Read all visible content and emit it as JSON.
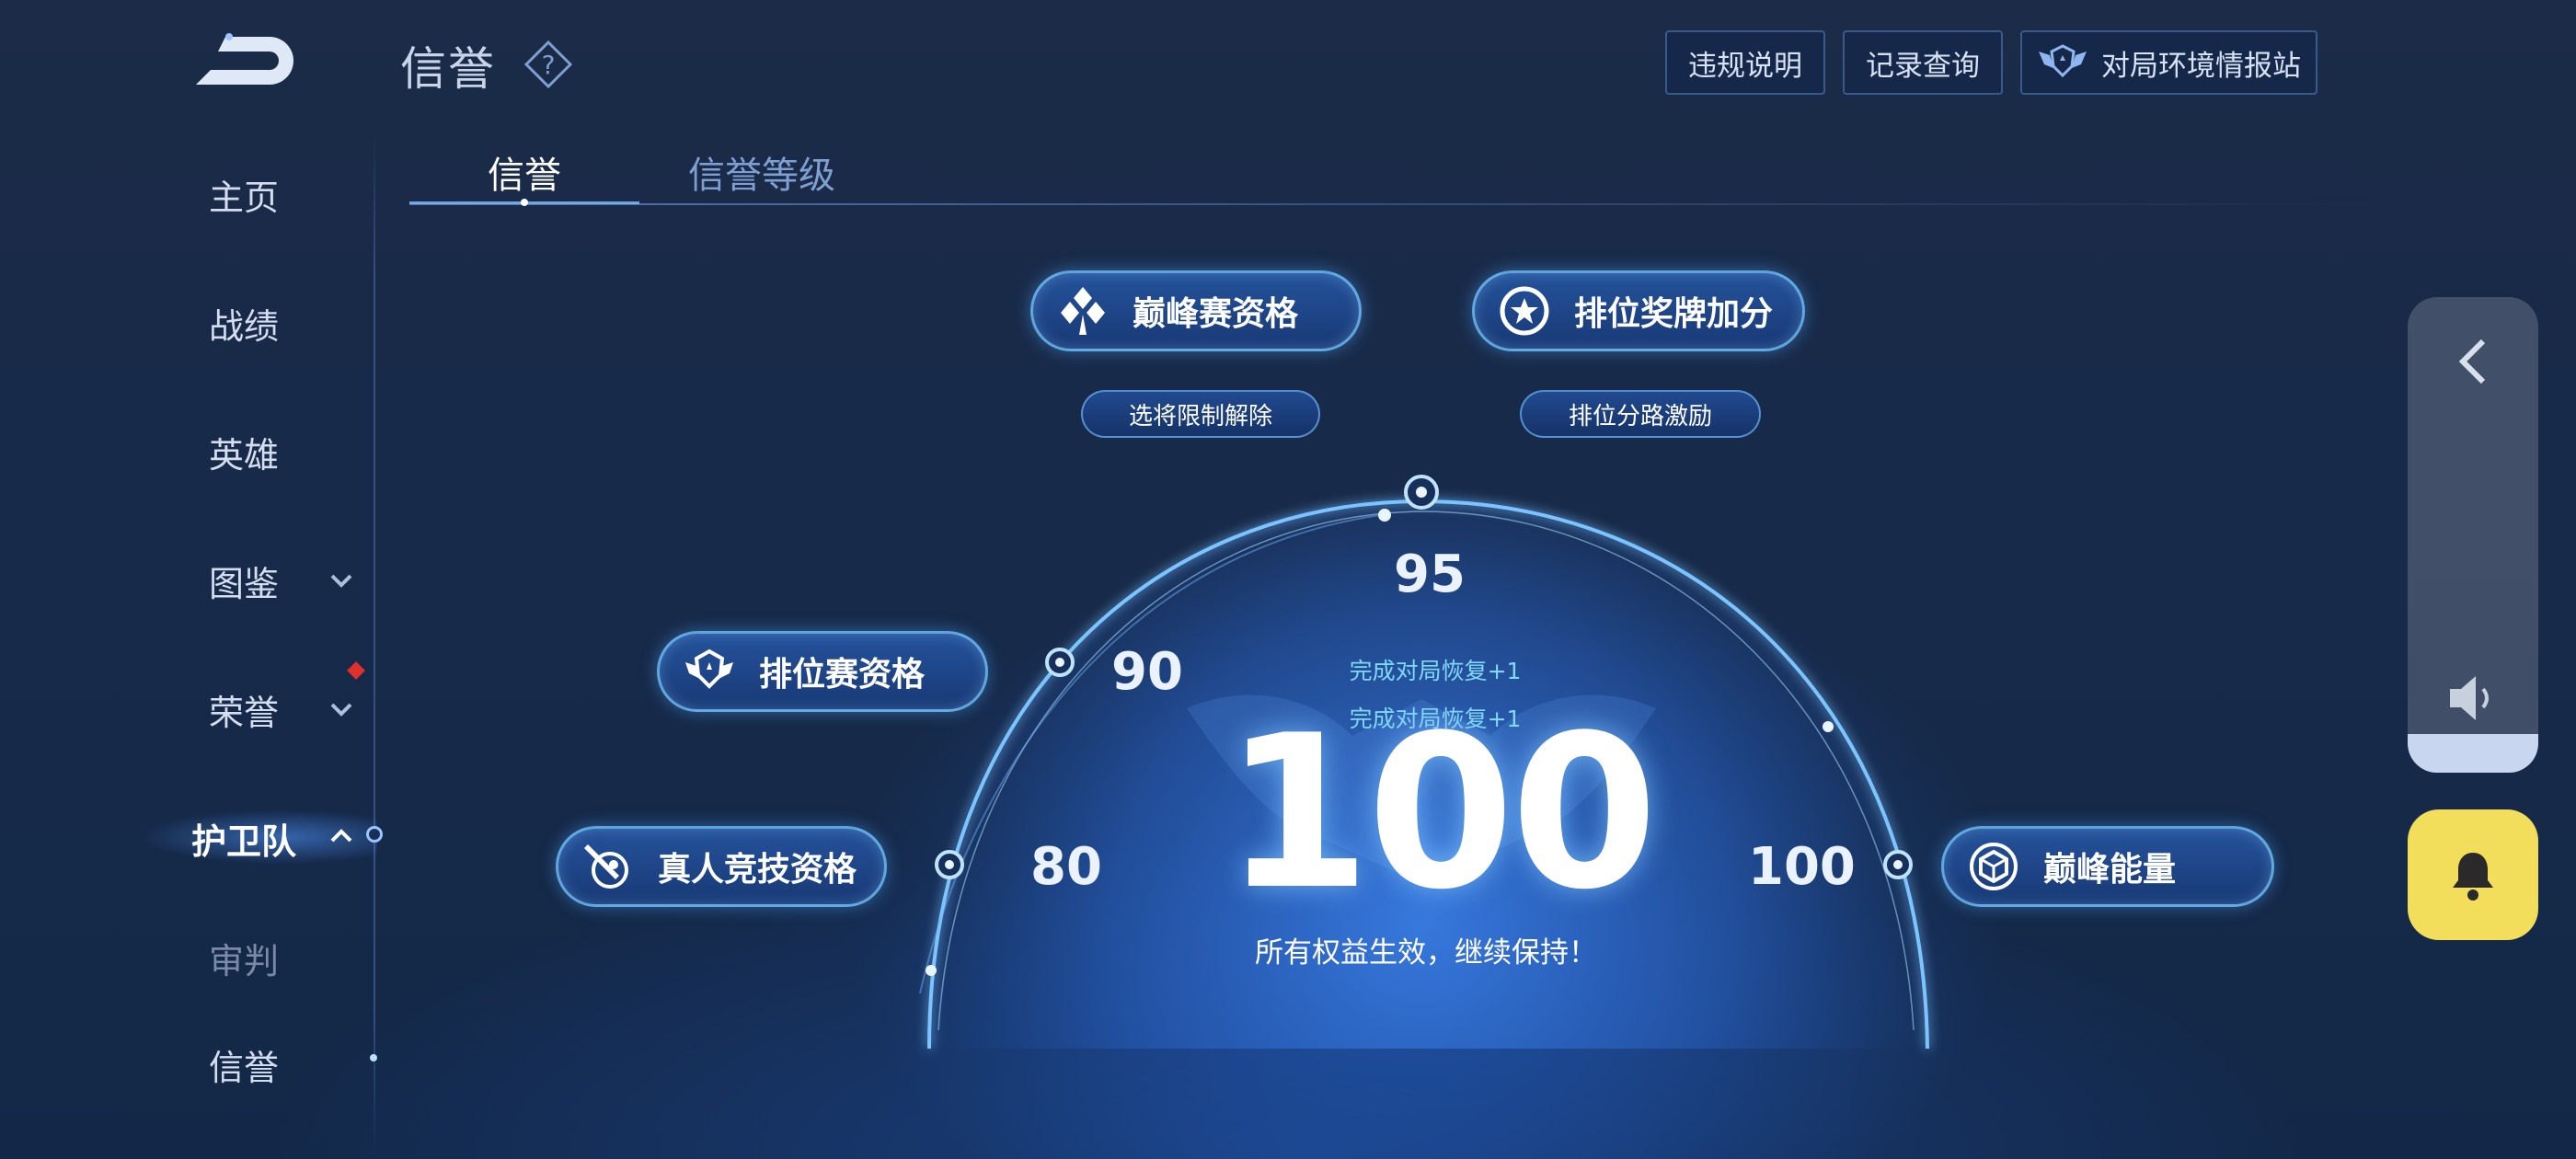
{
  "header": {
    "title": "信誉",
    "buttons": {
      "violation": "违规说明",
      "records": "记录查询",
      "environment": "对局环境情报站"
    }
  },
  "tabs": [
    {
      "label": "信誉",
      "active": true
    },
    {
      "label": "信誉等级",
      "active": false
    }
  ],
  "sidebar": {
    "items": [
      {
        "label": "主页"
      },
      {
        "label": "战绩"
      },
      {
        "label": "英雄"
      },
      {
        "label": "图鉴"
      },
      {
        "label": "荣誉"
      },
      {
        "label": "护卫队",
        "active": true
      },
      {
        "label": "审判"
      },
      {
        "label": "信誉"
      }
    ]
  },
  "gauge": {
    "score": "100",
    "caption": "所有权益生效，继续保持！",
    "recover_lines": [
      "完成对局恢复+1",
      "完成对局恢复+1"
    ],
    "ticks": [
      "80",
      "90",
      "95",
      "100"
    ]
  },
  "rewards": {
    "peak_match": "巅峰赛资格",
    "rank_medal": "排位奖牌加分",
    "hero_unlock": "选将限制解除",
    "lane_bonus": "排位分路激励",
    "ranked_match": "排位赛资格",
    "real_competition": "真人竞技资格",
    "peak_energy": "巅峰能量"
  },
  "colors": {
    "accent": "#5fb4ff",
    "bell": "#f2de5a",
    "alert": "#e0302c"
  }
}
